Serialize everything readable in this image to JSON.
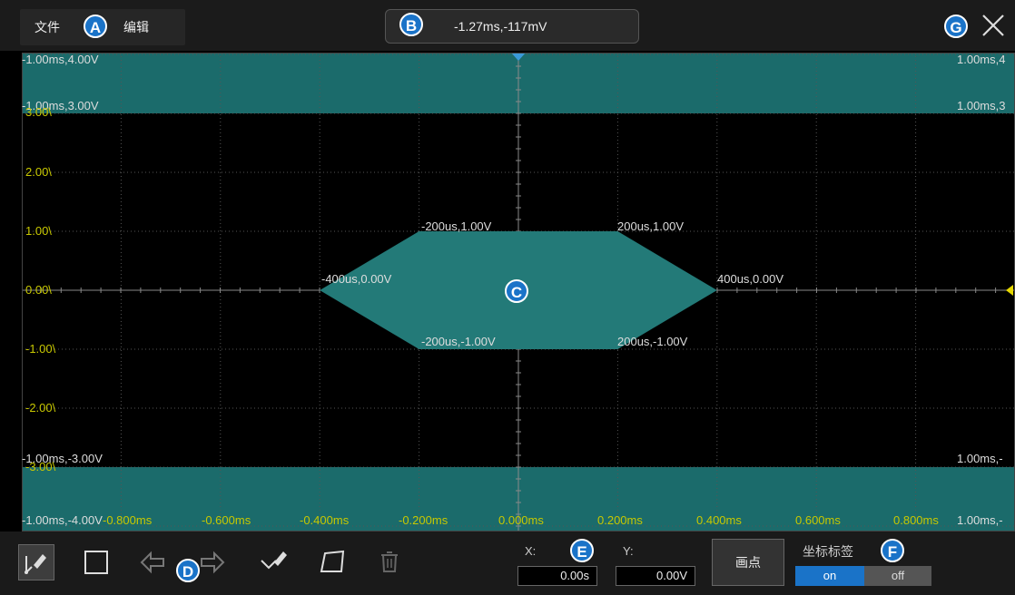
{
  "menu": {
    "file": "文件",
    "edit": "编辑"
  },
  "badges": {
    "a": "A",
    "b": "B",
    "c": "C",
    "d": "D",
    "e": "E",
    "f": "F",
    "g": "G"
  },
  "cursor_readout": "-1.27ms,-117mV",
  "plot": {
    "band_color": "#1b6b6b",
    "shape_color": "#237a78",
    "grid_color": "#555555",
    "axis_label_color": "#c8c800",
    "corner_labels": {
      "top_left": "-1.00ms,4.00V",
      "top_right": "1.00ms,4",
      "band_top_left": "-1.00ms,3.00V",
      "band_top_right": "1.00ms,3",
      "band_bottom_left": "-1.00ms,-3.00V",
      "band_bottom_right": "1.00ms,-",
      "bottom_left": "-1.00ms,-4.00V",
      "bottom_right": "1.00ms,-"
    },
    "y_ticks": [
      "3.00\\",
      "2.00\\",
      "1.00\\",
      "0.00\\",
      "-1.00\\",
      "-2.00\\",
      "-3.00\\"
    ],
    "x_ticks": [
      "-0.800ms",
      "-0.600ms",
      "-0.400ms",
      "-0.200ms",
      "0.000ms",
      "0.200ms",
      "0.400ms",
      "0.600ms",
      "0.800ms"
    ],
    "points": [
      {
        "label": "-400us,0.00V",
        "t_us": -400,
        "v": 0.0
      },
      {
        "label": "-200us,1.00V",
        "t_us": -200,
        "v": 1.0
      },
      {
        "label": "200us,1.00V",
        "t_us": 200,
        "v": 1.0
      },
      {
        "label": "400us,0.00V",
        "t_us": 400,
        "v": 0.0
      },
      {
        "label": "200us,-1.00V",
        "t_us": 200,
        "v": -1.0
      },
      {
        "label": "-200us,-1.00V",
        "t_us": -200,
        "v": -1.0
      }
    ]
  },
  "editor": {
    "x_label": "X:",
    "x_value": "0.00s",
    "y_label": "Y:",
    "y_value": "0.00V",
    "draw_point": "画点",
    "coord_label_title": "坐标标签",
    "toggle_on": "on",
    "toggle_off": "off"
  },
  "icons": {
    "draw_tool": "pen-line-icon",
    "rect_tool": "rectangle-icon",
    "undo": "undo-arrow-icon",
    "redo": "redo-arrow-icon",
    "edit_point": "edit-point-icon",
    "shape_tool": "quadrilateral-icon",
    "delete": "trash-icon",
    "close": "close-icon"
  }
}
